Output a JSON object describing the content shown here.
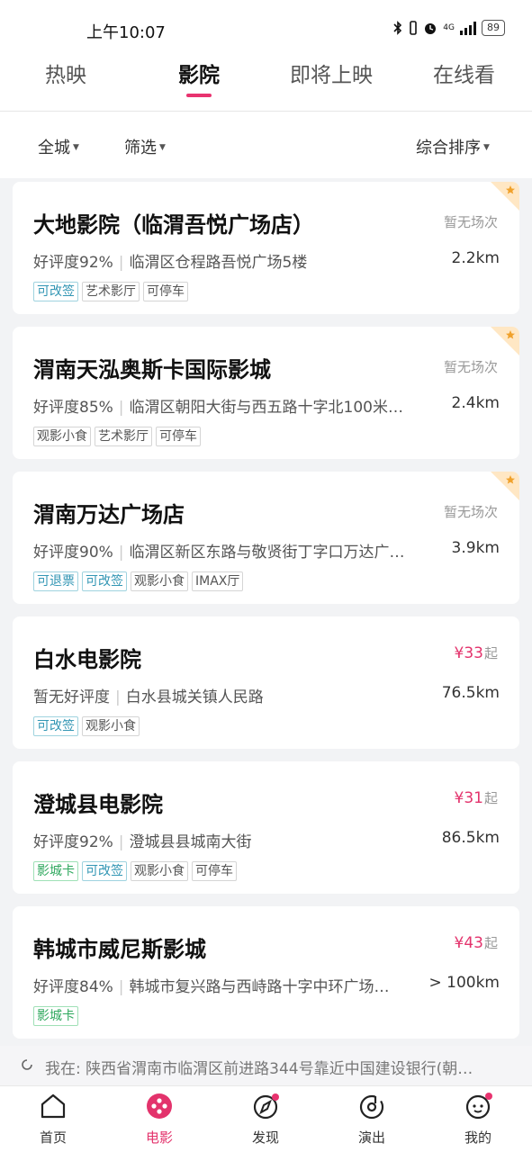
{
  "status_bar": {
    "time": "上午10:07",
    "network": "4G",
    "battery": "89"
  },
  "tabs": [
    {
      "label": "热映",
      "active": false
    },
    {
      "label": "影院",
      "active": true
    },
    {
      "label": "即将上映",
      "active": false
    },
    {
      "label": "在线看",
      "active": false
    }
  ],
  "filters": {
    "city": "全城",
    "filter": "筛选",
    "sort": "综合排序"
  },
  "cinemas": [
    {
      "name": "大地影院（临渭吾悦广场店）",
      "status": "暂无场次",
      "rating": "好评度92%",
      "address": "临渭区仓程路吾悦广场5楼",
      "distance": "2.2km",
      "tags": [
        "可改签",
        "艺术影厅",
        "可停车"
      ],
      "favorite": true
    },
    {
      "name": "渭南天泓奥斯卡国际影城",
      "status": "暂无场次",
      "rating": "好评度85%",
      "address": "临渭区朝阳大街与西五路十字北100米…",
      "distance": "2.4km",
      "tags": [
        "观影小食",
        "艺术影厅",
        "可停车"
      ],
      "favorite": true
    },
    {
      "name": "渭南万达广场店",
      "status": "暂无场次",
      "rating": "好评度90%",
      "address": "临渭区新区东路与敬贤街丁字口万达广…",
      "distance": "3.9km",
      "tags": [
        "可退票",
        "可改签",
        "观影小食",
        "IMAX厅"
      ],
      "favorite": true
    },
    {
      "name": "白水电影院",
      "price": "¥33",
      "price_suffix": "起",
      "rating": "暂无好评度",
      "address": "白水县城关镇人民路",
      "distance": "76.5km",
      "tags": [
        "可改签",
        "观影小食"
      ],
      "favorite": false
    },
    {
      "name": "澄城县电影院",
      "price": "¥31",
      "price_suffix": "起",
      "rating": "好评度92%",
      "address": "澄城县县城南大街",
      "distance": "86.5km",
      "tags": [
        "影城卡",
        "可改签",
        "观影小食",
        "可停车"
      ],
      "favorite": false
    },
    {
      "name": "韩城市威尼斯影城",
      "price": "¥43",
      "price_suffix": "起",
      "rating": "好评度84%",
      "address": "韩城市复兴路与西峙路十字中环广场…",
      "distance": "> 100km",
      "tags": [
        "影城卡"
      ],
      "favorite": false
    }
  ],
  "location": {
    "text": "我在:  陕西省渭南市临渭区前进路344号靠近中国建设银行(朝…"
  },
  "bottom_nav": [
    {
      "label": "首页",
      "icon": "home-icon",
      "active": false
    },
    {
      "label": "电影",
      "icon": "movie-reel-icon",
      "active": true
    },
    {
      "label": "发现",
      "icon": "compass-icon",
      "active": false
    },
    {
      "label": "演出",
      "icon": "show-disc-icon",
      "active": false
    },
    {
      "label": "我的",
      "icon": "profile-face-icon",
      "active": false
    }
  ],
  "colors": {
    "accent": "#e3336c",
    "tag_blue": "#3296b4",
    "tag_green": "#2fa85e",
    "favorite_corner": "#ffe7c4"
  }
}
